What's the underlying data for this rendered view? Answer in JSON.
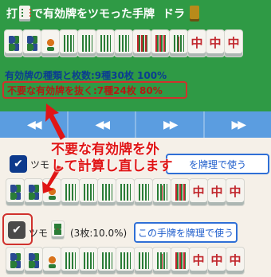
{
  "header": {
    "title_pre": "打",
    "title_post": "で有効牌をツモった手牌",
    "dora_label": "ドラ"
  },
  "hand_top": [
    "pin4",
    "pin4",
    "bird",
    "sou",
    "sou",
    "sou",
    "sou",
    "sou-mix",
    "sou-mix",
    "sou-red",
    "chun",
    "chun",
    "chun"
  ],
  "chun_char": "中",
  "effective_summary": "有効牌の種類と枚数:9種30枚 100%",
  "remove_summary": "不要な有効牌を抜く:7種24枚 80%",
  "nav": {
    "first": "◀◀",
    "prev": "◀◀",
    "next": "▶▶",
    "last": "▶▶"
  },
  "callout_text": {
    "line1": "不要な有効牌を外",
    "line2": "して計算し直します"
  },
  "option1": {
    "tsumo_label": "ツモ",
    "button": "を牌理で使う"
  },
  "option2": {
    "tsumo_label": "ツモ",
    "count": "(3枚:10.0%)",
    "button": "この手牌を牌理で使う"
  },
  "colors": {
    "table_green": "#2f9a45",
    "nav_blue": "#5b9de0",
    "accent_red": "#d0312d",
    "button_blue": "#2f6fd6"
  }
}
